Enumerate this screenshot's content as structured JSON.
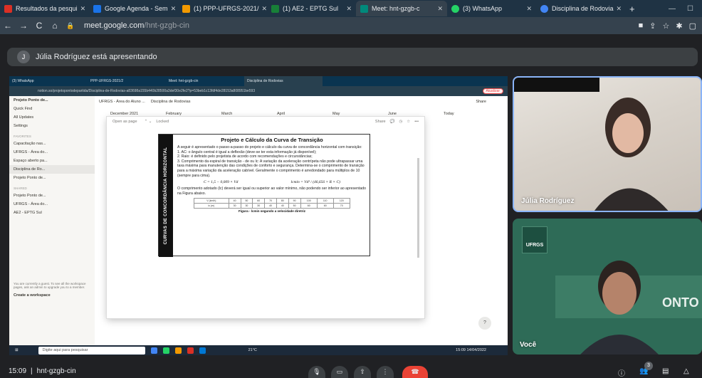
{
  "browser": {
    "tabs": [
      {
        "title": "Resultados da pesqui",
        "color": "#d93025"
      },
      {
        "title": "Google Agenda - Sem",
        "color": "#1a73e8"
      },
      {
        "title": "(1) PPP-UFRGS-2021/",
        "color": "#f29900"
      },
      {
        "title": "(1) AE2 - EPTG Sul",
        "color": "#188038"
      },
      {
        "title": "Meet: hnt-gzgb-c",
        "color": "#00897b"
      },
      {
        "title": "(3) WhatsApp",
        "color": "#25d366"
      },
      {
        "title": "Disciplina de Rodovia",
        "color": "#4285f4"
      }
    ],
    "url_host": "meet.google.com",
    "url_path": "/hnt-gzgb-cin"
  },
  "meet": {
    "presenter_initial": "J",
    "presenter_banner": "Júlia Rodríguez está apresentando",
    "tile1_name": "Júlia Rodríguez",
    "tile2_name": "Você",
    "time": "15:09",
    "separator": "|",
    "meeting_code": "hnt-gzgb-cin",
    "participant_count": "3"
  },
  "shared": {
    "inner_tabs": [
      "(3) WhatsApp",
      "PPP-UFRGS-2021/2",
      "Meet: hnt-gzgb-cin",
      "Disciplina de Rodovias"
    ],
    "inner_url": "notion.so/projetopontodepartida/Disciplina-de-Rodovias-a83698a155b440b28500a3def30e2fe2?p=53beb1c13fdf4de28153a808951be593",
    "update_label": "Atualizar",
    "sidebar_workspace": "Projeto Ponto de...",
    "sidebar_items": [
      "Quick Find",
      "All Updates",
      "Settings"
    ],
    "favorites_label": "FAVORITES",
    "favorites": [
      "Capacitação nas...",
      "UFRGS - Área do...",
      "Espaço aberto pa...",
      "Disciplina de Ro...",
      "Projeto Ponto de..."
    ],
    "shared_label": "SHARED",
    "shared_items": [
      "Projeto Ponto de...",
      "UFRGS - Área do...",
      "AE2 - EPTG Sul"
    ],
    "guest_note": "You are currently a guest. To see all the workspace pages, ask an admin to upgrade you to a member.",
    "create_workspace": "Create a workspace",
    "breadcrumb": [
      "UFRGS - Área do Aluno ...",
      "Disciplina de Rodovias"
    ],
    "share_label": "Share",
    "calendar_months": [
      "December 2021",
      "February",
      "March",
      "April",
      "May",
      "June"
    ],
    "today_label": "Today",
    "modal_open_as_page": "Open as page",
    "modal_locked": "Locked",
    "modal_share": "Share",
    "doc_side_title": "CURVAS DE CONCORDÂNCIA HORIZONTAL",
    "doc_title": "Projeto e Cálculo da Curva de Transição",
    "doc_intro": "A seguir é apresentado o passo-a-passo do projeto e cálculo da curva de concordância horizontal com transição:",
    "doc_step1": "1. AC: o ângulo central é igual a deflexão (deve-se ter esta informação já disponível);",
    "doc_step2": "2. Raio: é definido pelo projetista de acordo com recomendações e circunstâncias;",
    "doc_step3": "3. Comprimento da espiral de transição - de ou lc: A variação da aceleração centrípeta não pode ultrapassar uma taxa máxima para manutenção das condições de conforto e segurança. Determina-se o comprimento de transição para a máxima variação da aceleração cabível. Geralmente o comprimento é arredondado para múltiplos de 10 (sempre para cima).",
    "formula1": "C = 1,5 − 0,009 × Vd",
    "formula2": "lcmin = Vd³ / (46,656 × R × C)",
    "doc_after": "O comprimento adotado (lc) deverá ser igual ou superior ao valor mínimo, não podendo ser inferior ao apresentado na Figura abaixo.",
    "table_row1": [
      "V (km/h)",
      "40",
      "50",
      "60",
      "70",
      "80",
      "90",
      "100",
      "110",
      "120"
    ],
    "table_row2": [
      "lc (m)",
      "30",
      "30",
      "30",
      "40",
      "40",
      "50",
      "60",
      "60",
      "70"
    ],
    "figure_caption": "Figura - lcmin segundo a velocidade diretriz",
    "taskbar_search": "Digite aqui para pesquisar",
    "taskbar_temp": "21°C",
    "taskbar_time": "15:09",
    "taskbar_date": "14/04/2022",
    "help_label": "?"
  }
}
